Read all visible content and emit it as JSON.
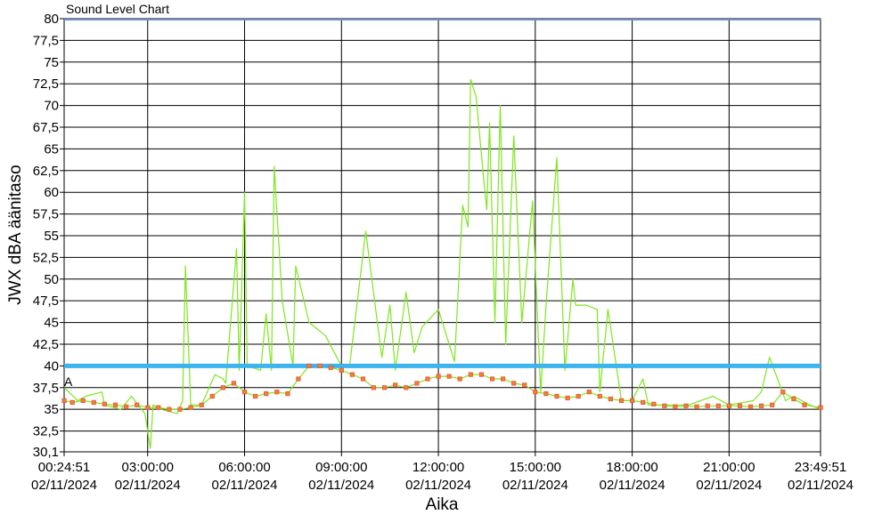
{
  "chart_data": {
    "type": "line",
    "title": "Sound Level Chart",
    "xlabel": "Aika",
    "ylabel": "JWX dBA äänitaso",
    "ylim": [
      30.1,
      80
    ],
    "xlim": [
      "00:24:51",
      "23:49:51"
    ],
    "yticks": [
      "80",
      "77,5",
      "75",
      "72,5",
      "70",
      "67,5",
      "65",
      "62,5",
      "60",
      "57,5",
      "55",
      "52,5",
      "50",
      "47,5",
      "45",
      "42,5",
      "40",
      "37,5",
      "35",
      "32,5",
      "30,1"
    ],
    "xticks": [
      {
        "time": "00:24:51",
        "date": "02/11/2024"
      },
      {
        "time": "03:00:00",
        "date": "02/11/2024"
      },
      {
        "time": "06:00:00",
        "date": "02/11/2024"
      },
      {
        "time": "09:00:00",
        "date": "02/11/2024"
      },
      {
        "time": "12:00:00",
        "date": "02/11/2024"
      },
      {
        "time": "15:00:00",
        "date": "02/11/2024"
      },
      {
        "time": "18:00:00",
        "date": "02/11/2024"
      },
      {
        "time": "21:00:00",
        "date": "02/11/2024"
      },
      {
        "time": "23:49:51",
        "date": "02/11/2024"
      }
    ],
    "grid": true,
    "threshold": {
      "value": 40,
      "color": "#3cb4ee"
    },
    "marker_label": "A",
    "colors": {
      "peak_line": "#7ee61e",
      "avg_marker": "#e8543a",
      "avg_marker_fill": "#f08030",
      "threshold": "#3cb4ee"
    },
    "series": [
      {
        "kind": "peak",
        "x": [
          "00:25",
          "00:50",
          "01:05",
          "01:35",
          "01:40",
          "02:10",
          "02:30",
          "02:55",
          "03:05",
          "03:10",
          "03:25",
          "03:55",
          "04:05",
          "04:10",
          "04:20",
          "04:40",
          "05:05",
          "05:20",
          "05:25",
          "05:45",
          "05:50",
          "06:00",
          "06:05",
          "06:30",
          "06:40",
          "06:50",
          "06:55",
          "07:10",
          "07:30",
          "07:35",
          "08:00",
          "08:30",
          "09:00",
          "09:15",
          "09:45",
          "10:15",
          "10:30",
          "10:40",
          "11:00",
          "11:15",
          "11:30",
          "12:00",
          "12:30",
          "12:45",
          "12:55",
          "13:00",
          "13:10",
          "13:25",
          "13:30",
          "13:35",
          "13:45",
          "13:55",
          "14:05",
          "14:20",
          "14:35",
          "14:55",
          "15:10",
          "15:20",
          "15:40",
          "15:55",
          "16:10",
          "16:15",
          "16:35",
          "16:55",
          "17:00",
          "17:15",
          "17:40",
          "18:00",
          "18:20",
          "18:30",
          "19:00",
          "19:45",
          "20:30",
          "21:00",
          "21:45",
          "22:00",
          "22:15",
          "22:45",
          "23:00",
          "23:30",
          "23:50"
        ],
        "y": [
          37.5,
          36,
          36.5,
          37,
          35.5,
          35,
          36.5,
          34.5,
          30.5,
          35.5,
          35,
          34.5,
          36,
          51.5,
          35.5,
          35.5,
          39,
          38.5,
          38,
          53.5,
          39.5,
          60,
          40,
          39.5,
          46,
          39.5,
          63,
          47.5,
          40,
          51.5,
          45,
          43.5,
          40,
          40,
          55.5,
          41,
          47,
          39.5,
          48.5,
          41.5,
          44.5,
          46.5,
          40.5,
          58.5,
          56,
          73,
          71,
          61,
          58,
          68,
          45,
          70,
          42.5,
          66.5,
          45,
          59,
          37,
          47,
          64,
          39.5,
          50,
          47,
          47,
          46.5,
          37,
          46.5,
          36,
          36,
          38.5,
          35.5,
          35.5,
          35.5,
          36.5,
          35.5,
          36,
          37,
          41,
          36,
          36.5,
          35.5,
          35
        ]
      },
      {
        "kind": "average",
        "x": [
          "00:25",
          "00:40",
          "01:00",
          "01:20",
          "01:40",
          "02:00",
          "02:20",
          "02:40",
          "03:00",
          "03:20",
          "03:40",
          "04:00",
          "04:20",
          "04:40",
          "05:00",
          "05:20",
          "05:40",
          "06:00",
          "06:20",
          "06:40",
          "07:00",
          "07:20",
          "07:40",
          "08:00",
          "08:20",
          "08:40",
          "09:00",
          "09:20",
          "09:40",
          "10:00",
          "10:20",
          "10:40",
          "11:00",
          "11:20",
          "11:40",
          "12:00",
          "12:20",
          "12:40",
          "13:00",
          "13:20",
          "13:40",
          "14:00",
          "14:20",
          "14:40",
          "15:00",
          "15:20",
          "15:40",
          "16:00",
          "16:20",
          "16:40",
          "17:00",
          "17:20",
          "17:40",
          "18:00",
          "18:20",
          "18:40",
          "19:00",
          "19:20",
          "19:40",
          "20:00",
          "20:20",
          "20:40",
          "21:00",
          "21:20",
          "21:40",
          "22:00",
          "22:20",
          "22:40",
          "23:00",
          "23:20",
          "23:50"
        ],
        "y": [
          36,
          35.8,
          36,
          35.8,
          35.6,
          35.5,
          35.3,
          35.5,
          35.2,
          35.2,
          35,
          35,
          35.2,
          35.5,
          36.5,
          37.5,
          38,
          37,
          36.5,
          36.8,
          37,
          36.8,
          38.5,
          40,
          40,
          39.8,
          39.5,
          39,
          38.5,
          37.5,
          37.5,
          37.8,
          37.5,
          38,
          38.5,
          38.8,
          38.8,
          38.5,
          39,
          39,
          38.5,
          38.5,
          38,
          37.8,
          37,
          36.8,
          36.5,
          36.3,
          36.5,
          37,
          36.5,
          36.2,
          36,
          36,
          35.8,
          35.6,
          35.4,
          35.3,
          35.4,
          35.3,
          35.4,
          35.4,
          35.4,
          35.4,
          35.3,
          35.4,
          35.5,
          37,
          36.2,
          35.5,
          35.2
        ]
      }
    ]
  }
}
